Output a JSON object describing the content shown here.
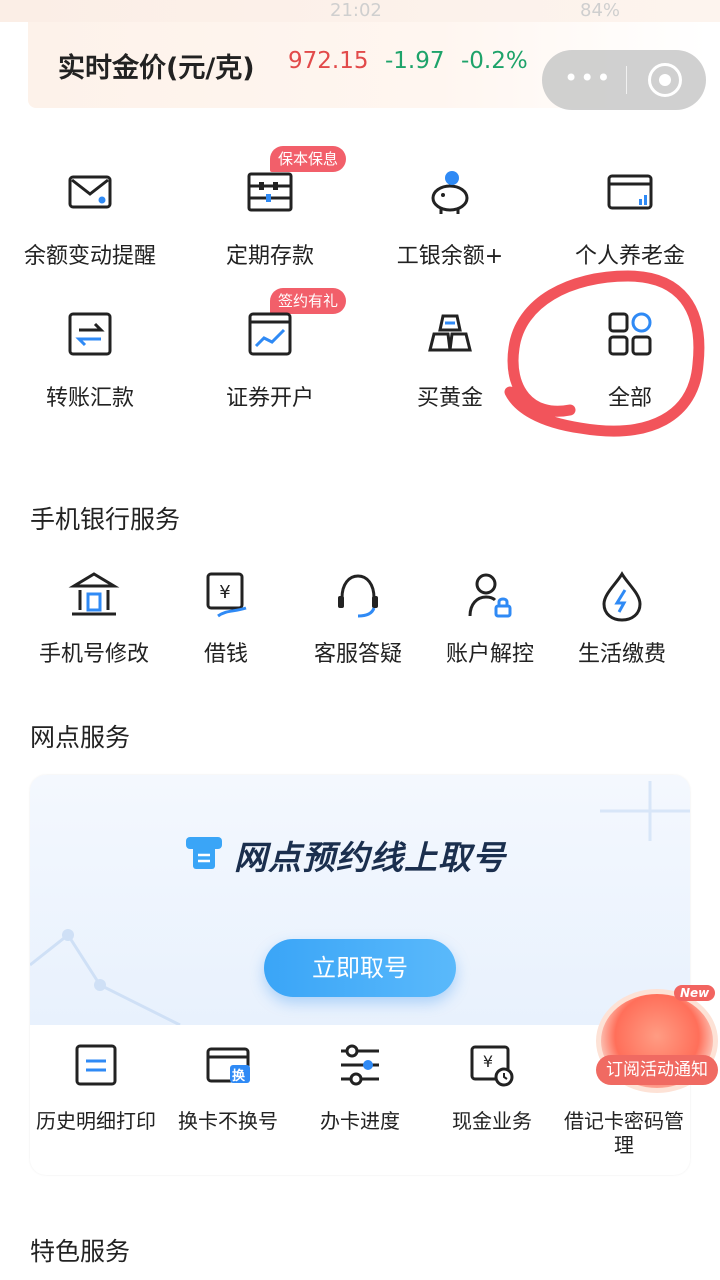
{
  "status_bar": {
    "time": "21:02",
    "battery": "84%"
  },
  "gold": {
    "title": "实时金价(元/克)",
    "price": "972.15",
    "change": "-1.97",
    "percent": "-0.2%"
  },
  "quick_actions": [
    {
      "label": "余额变动提醒",
      "icon": "envelope-icon"
    },
    {
      "label": "定期存款",
      "icon": "abacus-icon",
      "badge": "保本保息"
    },
    {
      "label": "工银余额+",
      "icon": "piggy-bank-icon"
    },
    {
      "label": "个人养老金",
      "icon": "card-chart-icon"
    },
    {
      "label": "转账汇款",
      "icon": "transfer-icon"
    },
    {
      "label": "证券开户",
      "icon": "stock-chart-icon",
      "badge": "签约有礼"
    },
    {
      "label": "买黄金",
      "icon": "gold-bars-icon"
    },
    {
      "label": "全部",
      "icon": "all-grid-icon"
    }
  ],
  "mobile_services": {
    "title": "手机银行服务",
    "items": [
      {
        "label": "手机号修改",
        "icon": "bank-icon"
      },
      {
        "label": "借钱",
        "icon": "loan-icon"
      },
      {
        "label": "客服答疑",
        "icon": "headset-icon"
      },
      {
        "label": "账户解控",
        "icon": "user-lock-icon"
      },
      {
        "label": "生活缴费",
        "icon": "utility-drop-icon"
      }
    ]
  },
  "branch_services": {
    "title": "网点服务",
    "hero_title": "网点预约线上取号",
    "button": "立即取号",
    "items": [
      {
        "label": "历史明细打印",
        "icon": "print-icon"
      },
      {
        "label": "换卡不换号",
        "icon": "card-swap-icon",
        "glyph": "换"
      },
      {
        "label": "办卡进度",
        "icon": "progress-sliders-icon"
      },
      {
        "label": "现金业务",
        "icon": "cash-icon"
      },
      {
        "label": "借记卡密码管理",
        "icon": "card-password-icon"
      }
    ]
  },
  "featured": {
    "title": "特色服务"
  },
  "promo": {
    "new_tag": "New",
    "label": "订阅活动通知"
  },
  "colors": {
    "accent_blue": "#3aa5f7",
    "price_red": "#e24a4a",
    "change_green": "#1ea36a",
    "badge_red": "#f25f6a"
  }
}
